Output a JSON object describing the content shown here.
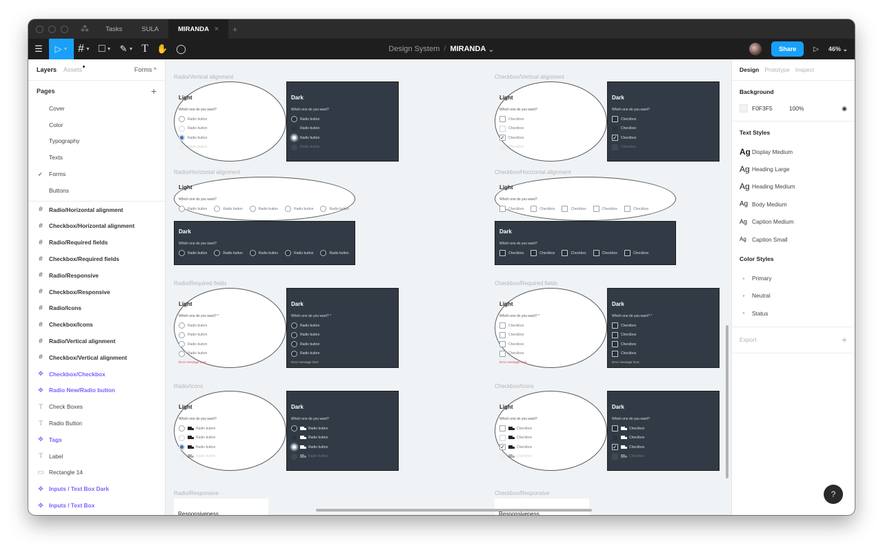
{
  "window": {
    "tabs": [
      {
        "label": "Tasks",
        "active": false
      },
      {
        "label": "SULA",
        "active": false
      },
      {
        "label": "MIRANDA",
        "active": true
      }
    ],
    "close_glyph": "×",
    "add_tab_glyph": "+"
  },
  "toolbar": {
    "tools": [
      {
        "name": "menu-icon",
        "glyph": "☰"
      },
      {
        "name": "move-tool-icon",
        "glyph": "▷",
        "selected": true
      },
      {
        "name": "frame-tool-icon",
        "glyph": "#"
      },
      {
        "name": "rectangle-tool-icon",
        "glyph": "□"
      },
      {
        "name": "pen-tool-icon",
        "glyph": "✎"
      },
      {
        "name": "text-tool-icon",
        "glyph": "T"
      },
      {
        "name": "hand-tool-icon",
        "glyph": "✋"
      },
      {
        "name": "comment-tool-icon",
        "glyph": "◯"
      }
    ],
    "breadcrumb": {
      "project": "Design System",
      "separator": "/",
      "file": "MIRANDA",
      "chevron": "⌄"
    },
    "share_label": "Share",
    "play_glyph": "▷",
    "zoom_level": "46%",
    "accent": "#18A0FB"
  },
  "left_panel": {
    "tabs": {
      "layers": "Layers",
      "assets": "Assets",
      "page_selector": "Forms ^"
    },
    "pages_heading": "Pages",
    "add_page_glyph": "+",
    "pages": [
      {
        "label": "Cover",
        "current": false
      },
      {
        "label": "Color",
        "current": false
      },
      {
        "label": "Typography",
        "current": false
      },
      {
        "label": "Texts",
        "current": false
      },
      {
        "label": "Forms",
        "current": true
      },
      {
        "label": "Buttons",
        "current": false
      }
    ],
    "current_mark": "✓",
    "layers": [
      {
        "label": "Radio/Horizontal alignment",
        "type": "frame"
      },
      {
        "label": "Checkbox/Horizontal alignment",
        "type": "frame"
      },
      {
        "label": "Radio/Required fields",
        "type": "frame"
      },
      {
        "label": "Checkbox/Required fields",
        "type": "frame"
      },
      {
        "label": "Radio/Responsive",
        "type": "frame"
      },
      {
        "label": "Checkbox/Responsive",
        "type": "frame"
      },
      {
        "label": "Radio/Icons",
        "type": "frame"
      },
      {
        "label": "Checkbox/Icons",
        "type": "frame"
      },
      {
        "label": "Radio/Vertical alignment",
        "type": "frame"
      },
      {
        "label": "Checkbox/Vertical alignment",
        "type": "frame"
      },
      {
        "label": "Checkbox/Checkbox",
        "type": "component"
      },
      {
        "label": "Radio New/Radio button",
        "type": "component"
      },
      {
        "label": "Check Boxes",
        "type": "text"
      },
      {
        "label": "Radio Button",
        "type": "text"
      },
      {
        "label": "Tags",
        "type": "component"
      },
      {
        "label": "Label",
        "type": "text"
      },
      {
        "label": "Rectangle 14",
        "type": "rectangle"
      },
      {
        "label": "Inputs / Text Box Dark",
        "type": "component"
      },
      {
        "label": "Inputs / Text Box",
        "type": "component"
      }
    ],
    "icons": {
      "frame": "#",
      "component": "✥",
      "text": "T",
      "rectangle": "▭"
    }
  },
  "canvas": {
    "background": "#F0F3F5",
    "common": {
      "light": "Light",
      "dark": "Dark",
      "question": "Which one do you want?",
      "question_required": "Which one do you want? *",
      "radio_label": "Radio button",
      "checkbox_label": "Checkbox",
      "error": "Error message here",
      "responsive": "Responsiveness",
      "check_glyph": "✓"
    },
    "frames": {
      "radio_vertical": "Radio/Vertical alignment",
      "radio_horizontal": "Radio/Horizontal alignment",
      "radio_required": "Radio/Required fields",
      "radio_icons": "Radio/Icons",
      "radio_responsive": "Radio/Responsive",
      "checkbox_vertical": "Checkbox/Vertical alignment",
      "checkbox_horizontal": "Checkbox/Horizontal alignment",
      "checkbox_required": "Checkbox/Required fields",
      "checkbox_icons": "Checkbox/Icons",
      "checkbox_responsive": "Checkbox/Responsive"
    },
    "state_sequence": [
      "default",
      "hover",
      "checked",
      "disabled"
    ],
    "dark_pane_color": "#323A45",
    "error_color": "#E0436B"
  },
  "right_panel": {
    "tabs": {
      "design": "Design",
      "prototype": "Prototype",
      "inspect": "Inspect"
    },
    "background": {
      "heading": "Background",
      "hex": "F0F3F5",
      "opacity": "100%",
      "eye_glyph": "◉"
    },
    "text_styles_heading": "Text Styles",
    "text_styles": [
      {
        "sample": "Ag",
        "label": "Display Medium"
      },
      {
        "sample": "Ag",
        "label": "Heading Large"
      },
      {
        "sample": "Ag",
        "label": "Heading Medium"
      },
      {
        "sample": "Ag",
        "label": "Body Medium"
      },
      {
        "sample": "Ag",
        "label": "Caption Medium"
      },
      {
        "sample": "Ag",
        "label": "Caption Small"
      }
    ],
    "color_styles_heading": "Color Styles",
    "color_styles": [
      {
        "label": "Primary"
      },
      {
        "label": "Neutral"
      },
      {
        "label": "Status"
      }
    ],
    "bullet_glyph": "▸",
    "export_label": "Export",
    "export_add_glyph": "+"
  },
  "help_glyph": "?"
}
